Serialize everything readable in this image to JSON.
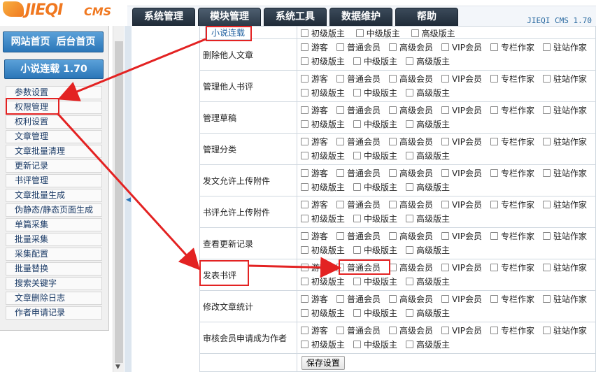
{
  "app": {
    "logo_text": "JIEQI",
    "logo_suffix": "CMS",
    "version": "JIEQI CMS 1.70"
  },
  "top_nav": [
    {
      "label": "系统管理"
    },
    {
      "label": "模块管理"
    },
    {
      "label": "系统工具"
    },
    {
      "label": "数据维护"
    },
    {
      "label": "帮助"
    }
  ],
  "submenu": {
    "label": "小说连载"
  },
  "sidebar": {
    "home": "网站首页",
    "admin_home": "后台首页",
    "module_title": "小说连载 1.70",
    "items": [
      {
        "label": "参数设置"
      },
      {
        "label": "权限管理"
      },
      {
        "label": "权利设置"
      },
      {
        "label": "文章管理"
      },
      {
        "label": "文章批量清理"
      },
      {
        "label": "更新记录"
      },
      {
        "label": "书评管理"
      },
      {
        "label": "文章批量生成"
      },
      {
        "label": "伪静态/静态页面生成"
      },
      {
        "label": "单篇采集"
      },
      {
        "label": "批量采集"
      },
      {
        "label": "采集配置"
      },
      {
        "label": "批量替换"
      },
      {
        "label": "搜索关键字"
      },
      {
        "label": "文章删除日志"
      },
      {
        "label": "作者申请记录"
      }
    ]
  },
  "options_row1": [
    "游客",
    "普通会员",
    "高级会员",
    "VIP会员",
    "专栏作家",
    "驻站作家"
  ],
  "options_row2": [
    "初级版主",
    "中级版主",
    "高级版主"
  ],
  "permissions": [
    {
      "label": "删除他人文章"
    },
    {
      "label": "管理他人书评"
    },
    {
      "label": "管理草稿"
    },
    {
      "label": "管理分类"
    },
    {
      "label": "发文允许上传附件"
    },
    {
      "label": "书评允许上传附件"
    },
    {
      "label": "查看更新记录"
    },
    {
      "label": "发表书评"
    },
    {
      "label": "修改文章统计"
    },
    {
      "label": "审核会员申请成为作者"
    }
  ],
  "save_button": "保存设置",
  "colors": {
    "accent": "#2b76b8",
    "highlight": "#e32222",
    "nav_dark": "#1f2b38"
  }
}
